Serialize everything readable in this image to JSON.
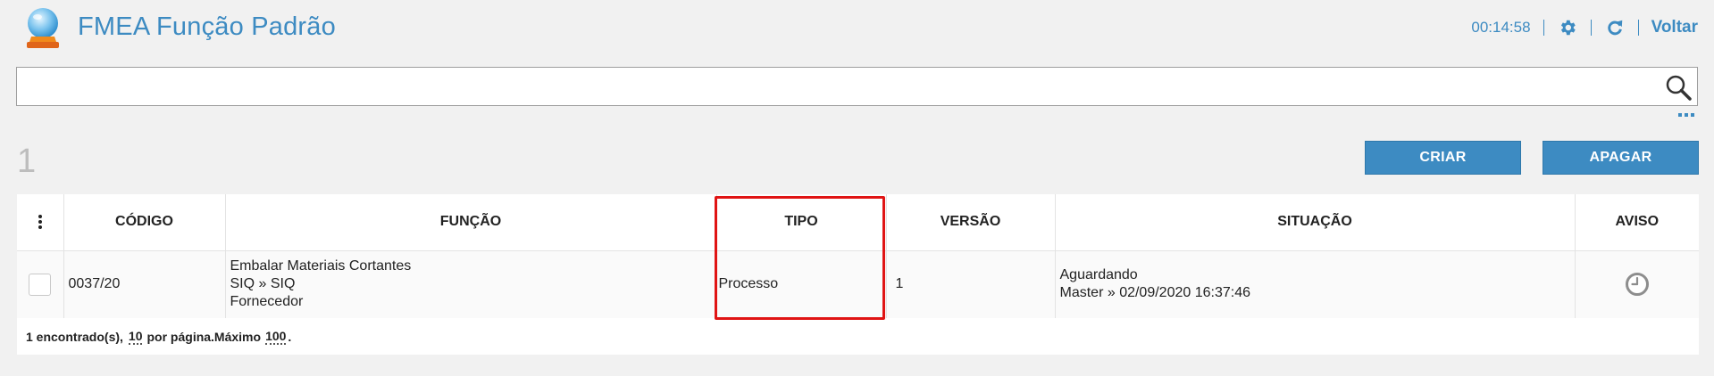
{
  "header": {
    "title": "FMEA Função Padrão",
    "timer": "00:14:58",
    "back_label": "Voltar",
    "icons": [
      "crystal-ball-logo",
      "gear-icon",
      "refresh-icon"
    ]
  },
  "search": {
    "value": "",
    "placeholder": ""
  },
  "toolbar": {
    "count": "1",
    "create_label": "CRIAR",
    "delete_label": "APAGAR"
  },
  "table": {
    "columns": [
      "CÓDIGO",
      "FUNÇÃO",
      "TIPO",
      "VERSÃO",
      "SITUAÇÃO",
      "AVISO"
    ],
    "rows": [
      {
        "codigo": "0037/20",
        "funcao_line1": "Embalar Materiais Cortantes",
        "funcao_line2": "SIQ » SIQ",
        "funcao_line3": "Fornecedor",
        "tipo": "Processo",
        "versao": "1",
        "situacao_line1": "Aguardando",
        "situacao_line2": "Master » 02/09/2020 16:37:46",
        "aviso_icon": "clock-icon"
      }
    ]
  },
  "footer": {
    "found_text": "1 encontrado(s),",
    "per_page_value": "10",
    "per_page_text": "por página.Máximo",
    "max_value": "100",
    "end_text": "."
  },
  "colors": {
    "accent": "#3d8bc2",
    "highlight": "#e01414",
    "background": "#f1f1f1"
  }
}
